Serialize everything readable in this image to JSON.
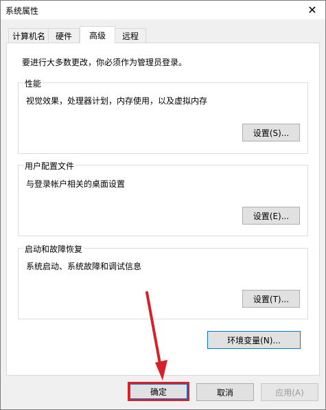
{
  "window": {
    "title": "系统属性",
    "close_glyph": "✕"
  },
  "tabs": [
    {
      "label": "计算机名"
    },
    {
      "label": "硬件"
    },
    {
      "label": "高级",
      "active": true
    },
    {
      "label": "远程"
    }
  ],
  "intro": "要进行大多数更改，你必须作为管理员登录。",
  "groups": {
    "performance": {
      "title": "性能",
      "desc": "视觉效果，处理器计划，内存使用，以及虚拟内存",
      "button": "设置(S)..."
    },
    "profile": {
      "title": "用户配置文件",
      "desc": "与登录帐户相关的桌面设置",
      "button": "设置(E)..."
    },
    "startup": {
      "title": "启动和故障恢复",
      "desc": "系统启动、系统故障和调试信息",
      "button": "设置(T)..."
    }
  },
  "env_button": "环境变量(N)...",
  "footer": {
    "ok": "确定",
    "cancel": "取消",
    "apply": "应用(A)"
  },
  "colors": {
    "highlight": "#d8202a",
    "accent": "#0078d7"
  }
}
